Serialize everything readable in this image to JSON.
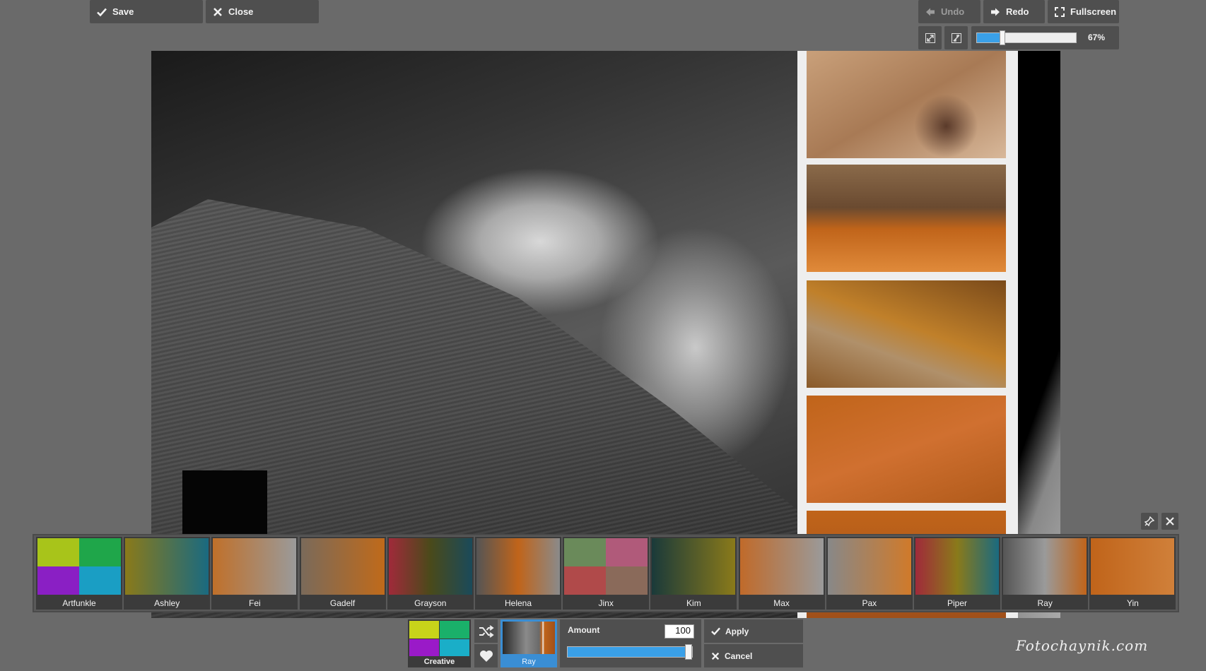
{
  "toolbar": {
    "save_label": "Save",
    "close_label": "Close",
    "undo_label": "Undo",
    "redo_label": "Redo",
    "fullscreen_label": "Fullscreen"
  },
  "zoom": {
    "value_label": "67%",
    "level": 0.26
  },
  "filters": [
    {
      "name": "Artfunkle",
      "colors": [
        "#a8c41a",
        "#1fa64a",
        "#8a1fc4",
        "#1a9ec4"
      ]
    },
    {
      "name": "Ashley",
      "colors": [
        "#8a7a1a",
        "#1a6a80"
      ]
    },
    {
      "name": "Fei",
      "colors": [
        "#c0702a",
        "#9a9a9a"
      ]
    },
    {
      "name": "Gadelf",
      "colors": [
        "#7a6a5a",
        "#c06a1a"
      ]
    },
    {
      "name": "Grayson",
      "colors": [
        "#a02a3a",
        "#4a4a1a",
        "#1a4a5a"
      ]
    },
    {
      "name": "Helena",
      "colors": [
        "#555555",
        "#c0641a",
        "#8a8a8a"
      ]
    },
    {
      "name": "Jinx",
      "colors": [
        "#6a8a5a",
        "#b05a7a",
        "#b04a4a",
        "#8a6a5a"
      ]
    },
    {
      "name": "Kim",
      "colors": [
        "#1a3a3a",
        "#8a7a1a"
      ]
    },
    {
      "name": "Max",
      "colors": [
        "#c06a2a",
        "#9a9a9a"
      ]
    },
    {
      "name": "Pax",
      "colors": [
        "#888888",
        "#d07a2a"
      ]
    },
    {
      "name": "Piper",
      "colors": [
        "#a02a3a",
        "#8a7a1a",
        "#1a6a80"
      ]
    },
    {
      "name": "Ray",
      "colors": [
        "#555555",
        "#9a9a9a",
        "#c0641a"
      ]
    },
    {
      "name": "Yin",
      "colors": [
        "#c0641a",
        "#d0803a"
      ]
    }
  ],
  "bottom": {
    "category_label": "Creative",
    "current_filter_label": "Ray",
    "amount_label": "Amount",
    "amount_value": "100",
    "amount_level": 1.0,
    "apply_label": "Apply",
    "cancel_label": "Cancel"
  },
  "watermark": "Fotochaynik.com",
  "icons": {
    "save": "checkmark-icon",
    "close": "close-icon",
    "undo": "arrow-left-icon",
    "redo": "arrow-right-icon",
    "fullscreen": "fullscreen-icon",
    "fit": "fit-to-screen-icon",
    "actual": "actual-size-icon",
    "pin": "pin-icon",
    "shuffle": "shuffle-icon",
    "favorite": "heart-icon"
  },
  "colors": {
    "accent": "#3aa0e8",
    "panel": "#4f4f4f",
    "background": "#6a6a6a"
  }
}
